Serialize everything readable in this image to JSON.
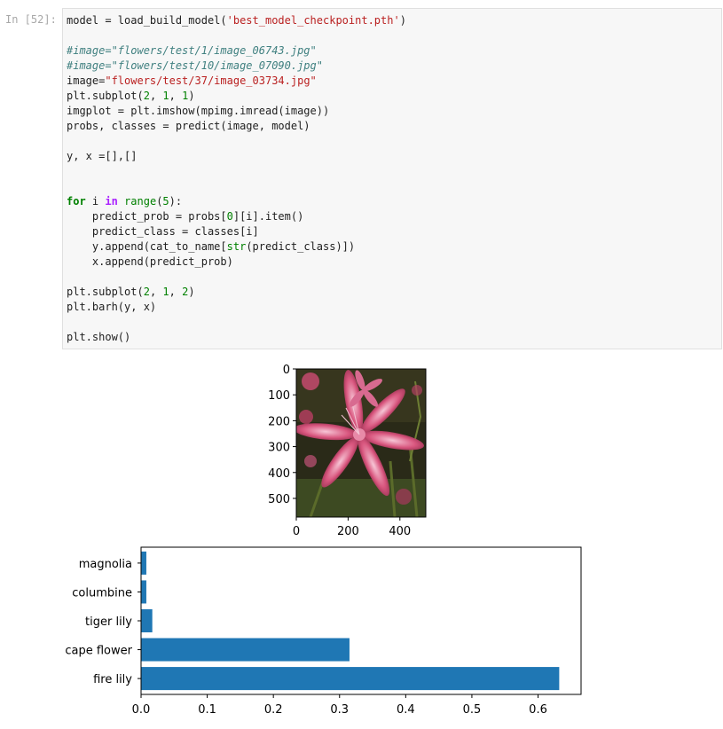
{
  "cell": {
    "prompt": "In [52]:",
    "code_lines": [
      [
        {
          "t": "model = load_build_model(",
          "c": ""
        },
        {
          "t": "'best_model_checkpoint.pth'",
          "c": "str"
        },
        {
          "t": ")",
          "c": ""
        }
      ],
      [],
      [
        {
          "t": "#image=\"flowers/test/1/image_06743.jpg\"",
          "c": "cm"
        }
      ],
      [
        {
          "t": "#image=\"flowers/test/10/image_07090.jpg\"",
          "c": "cm"
        }
      ],
      [
        {
          "t": "image=",
          "c": ""
        },
        {
          "t": "\"flowers/test/37/image_03734.jpg\"",
          "c": "str"
        }
      ],
      [
        {
          "t": "plt.subplot(",
          "c": ""
        },
        {
          "t": "2",
          "c": "num"
        },
        {
          "t": ", ",
          "c": ""
        },
        {
          "t": "1",
          "c": "num"
        },
        {
          "t": ", ",
          "c": ""
        },
        {
          "t": "1",
          "c": "num"
        },
        {
          "t": ")",
          "c": ""
        }
      ],
      [
        {
          "t": "imgplot = plt.imshow(mpimg.imread(image))",
          "c": ""
        }
      ],
      [
        {
          "t": "probs, classes = predict(image, model)",
          "c": ""
        }
      ],
      [],
      [
        {
          "t": "y, x =[],[]",
          "c": ""
        }
      ],
      [],
      [],
      [
        {
          "t": "for",
          "c": "kw"
        },
        {
          "t": " i ",
          "c": ""
        },
        {
          "t": "in",
          "c": "op"
        },
        {
          "t": " ",
          "c": ""
        },
        {
          "t": "range",
          "c": "bi"
        },
        {
          "t": "(",
          "c": ""
        },
        {
          "t": "5",
          "c": "num"
        },
        {
          "t": "):",
          "c": ""
        }
      ],
      [
        {
          "t": "    predict_prob = probs[",
          "c": ""
        },
        {
          "t": "0",
          "c": "num"
        },
        {
          "t": "][i].item()",
          "c": ""
        }
      ],
      [
        {
          "t": "    predict_class = classes[i]",
          "c": ""
        }
      ],
      [
        {
          "t": "    y.append(cat_to_name[",
          "c": ""
        },
        {
          "t": "str",
          "c": "bi"
        },
        {
          "t": "(predict_class)])",
          "c": ""
        }
      ],
      [
        {
          "t": "    x.append(predict_prob)",
          "c": ""
        }
      ],
      [],
      [
        {
          "t": "plt.subplot(",
          "c": ""
        },
        {
          "t": "2",
          "c": "num"
        },
        {
          "t": ", ",
          "c": ""
        },
        {
          "t": "1",
          "c": "num"
        },
        {
          "t": ", ",
          "c": ""
        },
        {
          "t": "2",
          "c": "num"
        },
        {
          "t": ")",
          "c": ""
        }
      ],
      [
        {
          "t": "plt.barh(y, x)",
          "c": ""
        }
      ],
      [],
      [
        {
          "t": "plt.show()",
          "c": ""
        }
      ]
    ]
  },
  "image_axes": {
    "y_ticks": [
      "0",
      "100",
      "200",
      "300",
      "400",
      "500"
    ],
    "x_ticks": [
      "0",
      "200",
      "400"
    ],
    "image_icon": "pink-flower-photo"
  },
  "chart_data": {
    "type": "bar",
    "orientation": "horizontal",
    "categories": [
      "fire lily",
      "cape flower",
      "tiger lily",
      "columbine",
      "magnolia"
    ],
    "values": [
      0.632,
      0.315,
      0.017,
      0.008,
      0.008
    ],
    "xlim": [
      0,
      0.665
    ],
    "x_ticks": [
      0.0,
      0.1,
      0.2,
      0.3,
      0.4,
      0.5,
      0.6
    ],
    "x_tick_labels": [
      "0.0",
      "0.1",
      "0.2",
      "0.3",
      "0.4",
      "0.5",
      "0.6"
    ],
    "title": "",
    "xlabel": "",
    "ylabel": "",
    "bar_color": "#1f77b4",
    "grid": false
  }
}
